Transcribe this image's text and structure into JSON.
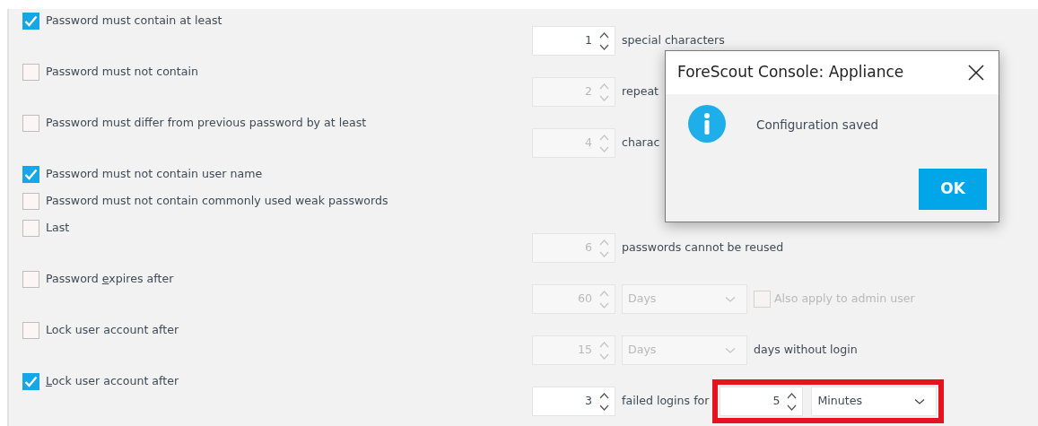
{
  "rows": [
    {
      "label": "Password must contain at least",
      "checked": true,
      "controls": [
        {
          "kind": "spinner",
          "value": "1",
          "disabled": false
        },
        {
          "kind": "text",
          "text": "special characters"
        }
      ]
    },
    {
      "label": "Password must not contain",
      "checked": false,
      "controls": [
        {
          "kind": "spinner",
          "value": "2",
          "disabled": true
        },
        {
          "kind": "text",
          "text": "repeat"
        }
      ]
    },
    {
      "label": "Password must differ from previous password by at least",
      "checked": false,
      "controls": [
        {
          "kind": "spinner",
          "value": "4",
          "disabled": true
        },
        {
          "kind": "text",
          "text": "charac"
        }
      ]
    },
    {
      "label": "Password must not contain user name",
      "checked": true,
      "controls": []
    },
    {
      "label": "Password must not contain commonly used weak passwords",
      "checked": false,
      "controls": []
    },
    {
      "label": "Last",
      "checked": false,
      "controls": [
        {
          "kind": "spinner",
          "value": "6",
          "disabled": true
        },
        {
          "kind": "text",
          "text": "passwords cannot be reused"
        }
      ]
    },
    {
      "label_before": "Password ",
      "access_key": "e",
      "label_after": "xpires after",
      "checked": false,
      "controls": [
        {
          "kind": "spinner",
          "value": "60",
          "disabled": true
        },
        {
          "kind": "dropdown",
          "value": "Days",
          "disabled": true
        },
        {
          "kind": "checkbox",
          "label": "Also apply to admin user",
          "checked": false,
          "disabled": true
        }
      ]
    },
    {
      "label": "Lock user account after",
      "checked": false,
      "controls": [
        {
          "kind": "spinner",
          "value": "15",
          "disabled": true
        },
        {
          "kind": "dropdown",
          "value": "Days",
          "disabled": true
        },
        {
          "kind": "text",
          "text": "days without login"
        }
      ]
    },
    {
      "label_before": "",
      "access_key": "L",
      "label_after": "ock user account after",
      "checked": true,
      "controls": [
        {
          "kind": "spinner",
          "value": "3",
          "disabled": false
        },
        {
          "kind": "text",
          "text": "failed logins for"
        },
        {
          "kind": "highlight",
          "controls": [
            {
              "kind": "spinner",
              "value": "5",
              "disabled": false
            },
            {
              "kind": "dropdown",
              "value": "Minutes",
              "disabled": false
            }
          ]
        }
      ]
    }
  ],
  "dialog": {
    "title": "ForeScout Console: Appliance",
    "message": "Configuration saved",
    "button": "OK"
  }
}
